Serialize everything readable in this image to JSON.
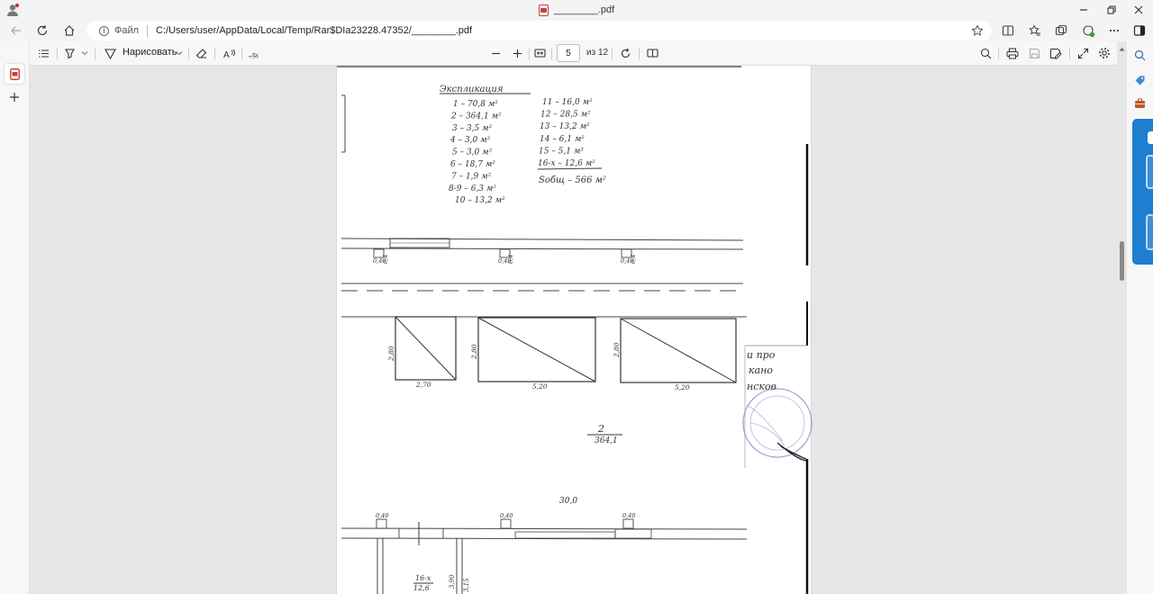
{
  "window": {
    "title": "________.pdf"
  },
  "address_bar": {
    "scheme_label": "Файл",
    "url": "C:/Users/user/AppData/Local/Temp/Rar$DIa23228.47352/________.pdf"
  },
  "pdf_toolbar": {
    "draw_label": "Нарисовать",
    "page_number": "5",
    "page_of": "из 12"
  },
  "document": {
    "explication": {
      "heading": "Экспликация",
      "left_column": [
        "1 – 70,8 м²",
        "2 – 364,1 м²",
        "3 – 3,5 м²",
        "4 – 3,0 м²",
        "5 – 3,0 м²",
        "6 – 18,7 м²",
        "7 – 1,9 м²",
        "8-9 – 6,3 м²",
        "10 – 13,2 м²"
      ],
      "right_column": [
        "11 – 16,0 м²",
        "12 – 28,5 м²",
        "13 – 13,2 м²",
        "14 – 6,1 м²",
        "15 – 5,1 м²",
        "16-х – 12,6 м²"
      ],
      "total": "Sобщ – 566 м²"
    },
    "window_marks_top": [
      "0,40",
      "0,40",
      "0,40"
    ],
    "window_heights_top": [
      "0,4",
      "0,4",
      "0,4"
    ],
    "bays": [
      {
        "height": "2,80",
        "width": "2,70"
      },
      {
        "height": "2,80",
        "width": "5,20"
      },
      {
        "height": "2,80",
        "width": "5,20"
      }
    ],
    "room_number": "2",
    "room_area": "364,1",
    "overall_length": "30,0",
    "window_marks_bottom": [
      "0,40",
      "0,40",
      "0,40"
    ],
    "bottom_room_number": "16-х",
    "bottom_room_area": "12,6",
    "bottom_dims": [
      "3,90",
      "3,15"
    ],
    "stamp_lines": [
      "и про",
      "кано",
      "нсков"
    ]
  }
}
